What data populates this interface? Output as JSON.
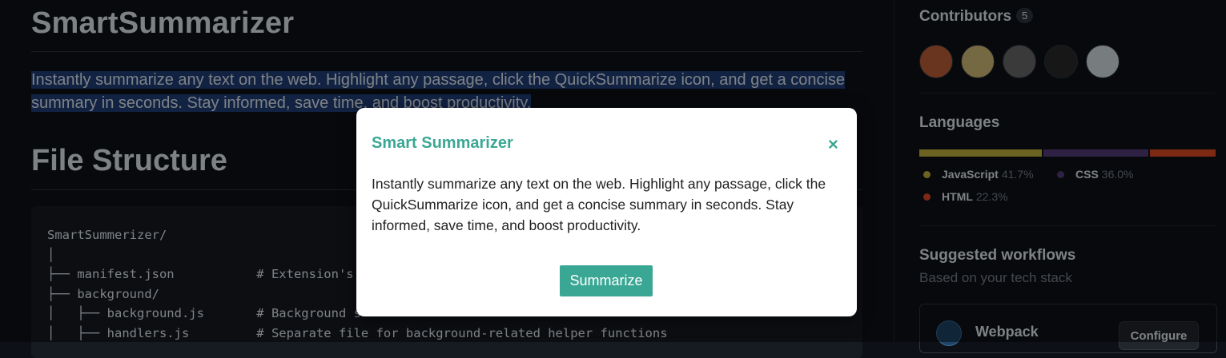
{
  "readme": {
    "title": "SmartSummarizer",
    "description": "Instantly summarize any text on the web. Highlight any passage, click the QuickSummarize icon, and get a concise summary in seconds. Stay informed, save time, and boost productivity.",
    "section_title": "File Structure",
    "code": "SmartSummerizer/\n│\n├── manifest.json           # Extension's\n├── background/\n│   ├── background.js       # Background s\n│   ├── handlers.js         # Separate file for background-related helper functions"
  },
  "sidebar": {
    "contributors_title": "Contributors",
    "contributors_count": "5",
    "avatars": [
      {
        "name": "contributor-1",
        "color": "#c0623a"
      },
      {
        "name": "contributor-2",
        "color": "#d6c07a"
      },
      {
        "name": "contributor-3",
        "color": "#6b6b6b"
      },
      {
        "name": "contributor-4",
        "color": "#2a2a2a"
      },
      {
        "name": "contributor-5",
        "color": "#d9e3e6"
      }
    ],
    "languages_title": "Languages",
    "languages": [
      {
        "name": "JavaScript",
        "percent": "41.7%",
        "value": 41.7,
        "color": "#c5b43c"
      },
      {
        "name": "CSS",
        "percent": "36.0%",
        "value": 36.0,
        "color": "#563d7c"
      },
      {
        "name": "HTML",
        "percent": "22.3%",
        "value": 22.3,
        "color": "#e34c26"
      }
    ],
    "workflows_title": "Suggested workflows",
    "workflows_subtitle": "Based on your tech stack",
    "workflow": {
      "name": "Webpack",
      "button_label": "Configure"
    }
  },
  "modal": {
    "title": "Smart Summarizer",
    "close_glyph": "×",
    "body": "Instantly summarize any text on the web. Highlight any passage, click the QuickSummarize icon, and get a concise summary in seconds. Stay informed, save time, and boost productivity.",
    "button_label": "Summarize",
    "accent_color": "#3aa794"
  }
}
